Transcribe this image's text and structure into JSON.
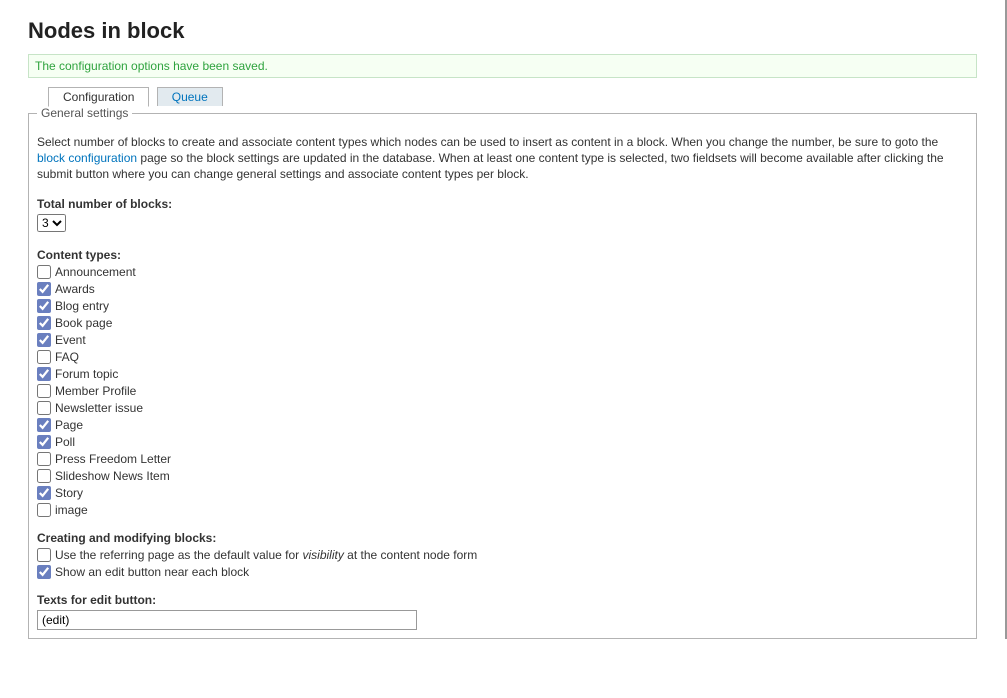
{
  "page_title": "Nodes in block",
  "status_message": "The configuration options have been saved.",
  "tabs": {
    "configuration": "Configuration",
    "queue": "Queue"
  },
  "fieldset_legend": "General settings",
  "help_text": {
    "pre": "Select number of blocks to create and associate content types which nodes can be used to insert as content in a block. When you change the number, be sure to goto the ",
    "link": "block configuration",
    "post": " page so the block settings are updated in the database. When at least one content type is selected, two fieldsets will become available after clicking the submit button where you can change general settings and associate content types per block."
  },
  "total_blocks_label": "Total number of blocks:",
  "total_blocks_value": "3",
  "content_types_label": "Content types:",
  "content_types": [
    {
      "label": "Announcement",
      "checked": false
    },
    {
      "label": "Awards",
      "checked": true
    },
    {
      "label": "Blog entry",
      "checked": true
    },
    {
      "label": "Book page",
      "checked": true
    },
    {
      "label": "Event",
      "checked": true
    },
    {
      "label": "FAQ",
      "checked": false
    },
    {
      "label": "Forum topic",
      "checked": true
    },
    {
      "label": "Member Profile",
      "checked": false
    },
    {
      "label": "Newsletter issue",
      "checked": false
    },
    {
      "label": "Page",
      "checked": true
    },
    {
      "label": "Poll",
      "checked": true
    },
    {
      "label": "Press Freedom Letter",
      "checked": false
    },
    {
      "label": "Slideshow News Item",
      "checked": false
    },
    {
      "label": "Story",
      "checked": true
    },
    {
      "label": "image",
      "checked": false
    }
  ],
  "creating_label": "Creating and modifying blocks:",
  "opt_referring": {
    "pre": "Use the referring page as the default value for ",
    "em": "visibility",
    "post": " at the content node form",
    "checked": false
  },
  "opt_editbtn": {
    "label": "Show an edit button near each block",
    "checked": true
  },
  "texts_label": "Texts for edit button:",
  "texts_value": "(edit)"
}
